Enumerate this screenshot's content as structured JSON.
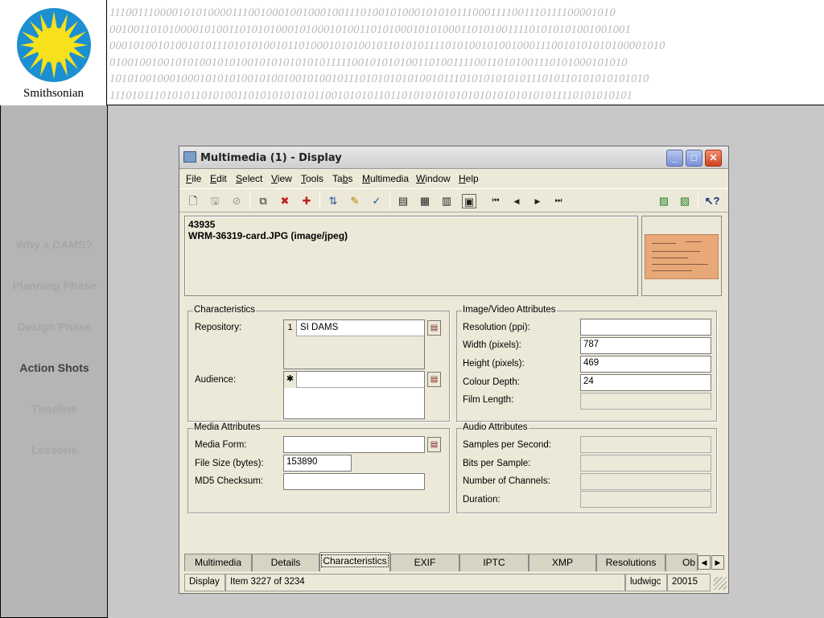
{
  "header": {
    "logo_text": "Smithsonian",
    "binary_lines": [
      "111001110000101010000111001000100100010011101001010001010101110001111001110111100001010",
      "0010011010100001010011010101000101000101001101010001010100011010100111101010101001001001",
      "0001010010100101011101010100101101000101010010110101011110101001010010001110010101010100001010",
      "0100100100101010010101001010101010101111100101010100110100111100110101001110101000101010",
      "1010100100010001010101001010010010100101110101010101001011101010101010111010110101010101010",
      "11101011101010110101001101010101010110010101011011010101010101010101010101011110101010101"
    ]
  },
  "sidebar": {
    "items": [
      {
        "label": "Why a DAMS?"
      },
      {
        "label": "Planning Phase"
      },
      {
        "label": "Design Phase"
      },
      {
        "label": "Action Shots"
      },
      {
        "label": "Timeline"
      },
      {
        "label": "Lessons"
      }
    ]
  },
  "window": {
    "title": "Multimedia (1) - Display",
    "controls": {
      "minimize": "_",
      "maximize": "□",
      "close": "✕"
    },
    "menu": [
      {
        "u": "F",
        "rest": "ile"
      },
      {
        "u": "E",
        "rest": "dit"
      },
      {
        "u": "S",
        "rest": "elect"
      },
      {
        "u": "V",
        "rest": "iew"
      },
      {
        "u": "T",
        "rest": "ools"
      },
      {
        "pre": "Ta",
        "u": "b",
        "rest": "s"
      },
      {
        "u": "M",
        "rest": "ultimedia"
      },
      {
        "u": "W",
        "rest": "indow"
      },
      {
        "u": "H",
        "rest": "elp"
      }
    ],
    "toolbar": {
      "new": "🗋",
      "save": "🖫",
      "cancel": "⊘",
      "open": "⧉",
      "delete": "✖",
      "copy": "✚",
      "sort": "⇅",
      "edit": "✎",
      "spell": "✓",
      "list": "▤",
      "grid": "▦",
      "page": "▥",
      "display": "▣",
      "first": "⏮",
      "prev": "◀",
      "next": "▶",
      "last": "⏭",
      "attach": "▨",
      "attach_multi": "▧",
      "help": "↖?"
    },
    "record": {
      "id": "43935",
      "file": "WRM-36319-card.JPG (image/jpeg)"
    },
    "characteristics": {
      "title": "Characteristics",
      "repository_label": "Repository:",
      "repository_index": "1",
      "repository_value": "SI DAMS",
      "audience_label": "Audience:",
      "audience_index": "✱",
      "audience_value": ""
    },
    "image_video": {
      "title": "Image/Video Attributes",
      "resolution_label": "Resolution (ppi):",
      "resolution_value": "",
      "width_label": "Width (pixels):",
      "width_value": "787",
      "height_label": "Height (pixels):",
      "height_value": "469",
      "depth_label": "Colour Depth:",
      "depth_value": "24",
      "film_label": "Film Length:",
      "film_value": ""
    },
    "media": {
      "title": "Media Attributes",
      "form_label": "Media Form:",
      "form_value": "",
      "size_label": "File Size (bytes):",
      "size_value": "153890",
      "md5_label": "MD5 Checksum:",
      "md5_value": ""
    },
    "audio": {
      "title": "Audio Attributes",
      "sps_label": "Samples per Second:",
      "bps_label": "Bits per Sample:",
      "channels_label": "Number of Channels:",
      "duration_label": "Duration:"
    },
    "tabs": [
      {
        "label": "Multimedia"
      },
      {
        "label": "Details"
      },
      {
        "label": "Characteristics"
      },
      {
        "label": "EXIF"
      },
      {
        "label": "IPTC"
      },
      {
        "label": "XMP"
      },
      {
        "label": "Resolutions"
      },
      {
        "label": "Ob"
      }
    ],
    "status": {
      "mode": "Display",
      "item": "Item 3227 of 3234",
      "user": "ludwigc",
      "code": "20015"
    }
  }
}
